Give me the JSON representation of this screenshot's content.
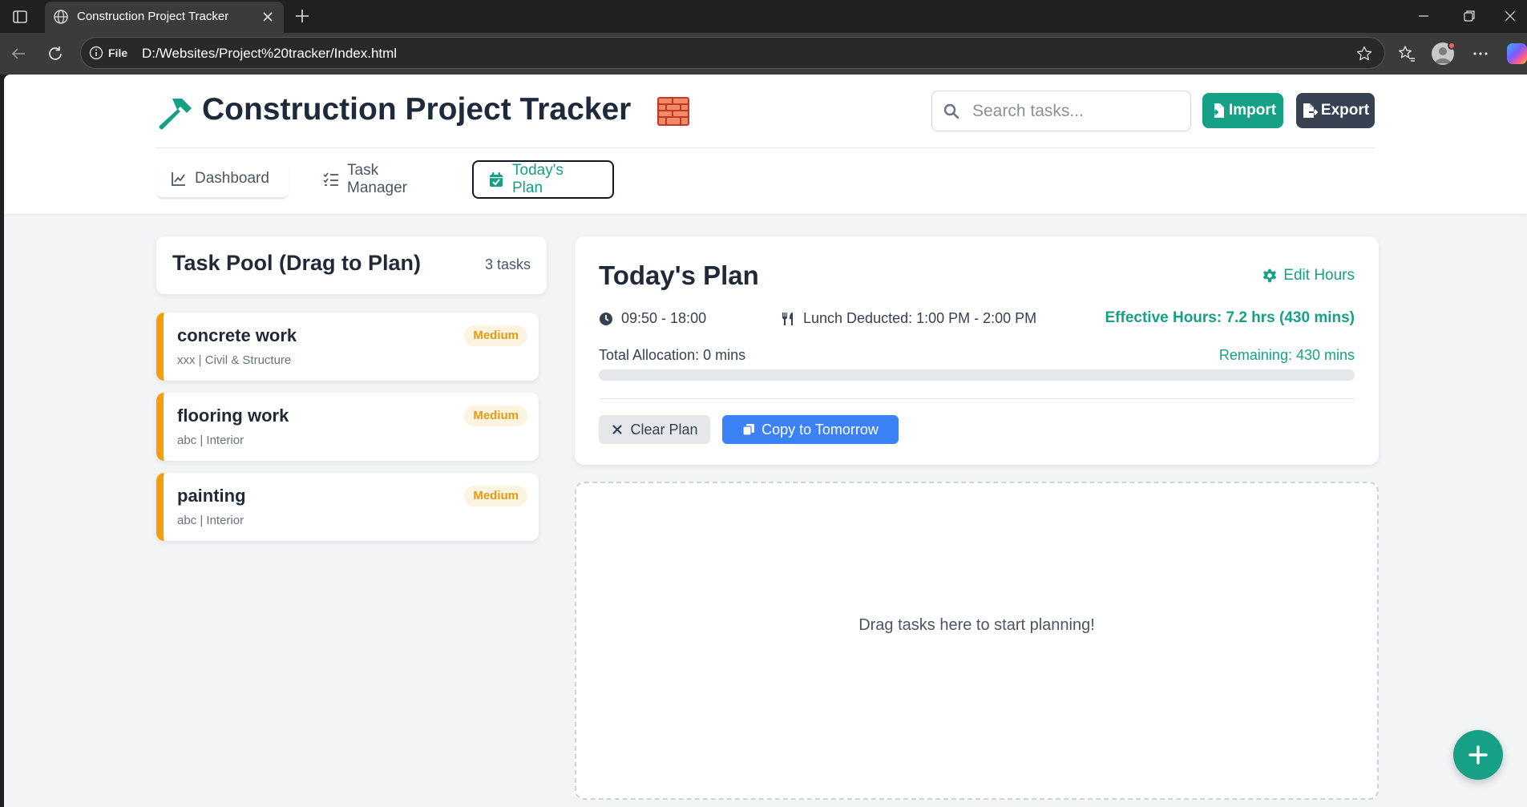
{
  "browser": {
    "tab_title": "Construction Project Tracker",
    "omnibox_scheme": "File",
    "url": "D:/Websites/Project%20tracker/Index.html"
  },
  "header": {
    "title": "Construction Project Tracker",
    "search_placeholder": "Search tasks...",
    "import_label": "Import",
    "export_label": "Export"
  },
  "nav": {
    "tabs": [
      {
        "label": "Dashboard",
        "icon": "chart-line-icon",
        "active": false
      },
      {
        "label": "Task Manager",
        "icon": "list-check-icon",
        "active": false
      },
      {
        "label": "Today's Plan",
        "icon": "calendar-check-icon",
        "active": true
      }
    ]
  },
  "pool": {
    "title": "Task Pool (Drag to Plan)",
    "count": "3 tasks",
    "tasks": [
      {
        "name": "concrete work",
        "meta": "xxx | Civil & Structure",
        "priority": "Medium"
      },
      {
        "name": "flooring work",
        "meta": "abc | Interior",
        "priority": "Medium"
      },
      {
        "name": "painting",
        "meta": "abc | Interior",
        "priority": "Medium"
      }
    ]
  },
  "plan": {
    "title": "Today's Plan",
    "edit_hours_label": "Edit Hours",
    "time_range": "09:50 - 18:00",
    "lunch": "Lunch Deducted: 1:00 PM - 2:00 PM",
    "effective_hours": "Effective Hours: 7.2 hrs (430 mins)",
    "total_allocation": "Total Allocation: 0 mins",
    "remaining": "Remaining: 430 mins",
    "allocation_fraction": 0,
    "clear_label": "Clear Plan",
    "copy_label": "Copy to Tomorrow",
    "drop_text": "Drag tasks here to start planning!"
  },
  "colors": {
    "accent": "#16a085",
    "priority_medium": "#f59e0b",
    "copy_button": "#3b82f6",
    "export_button": "#374151"
  }
}
